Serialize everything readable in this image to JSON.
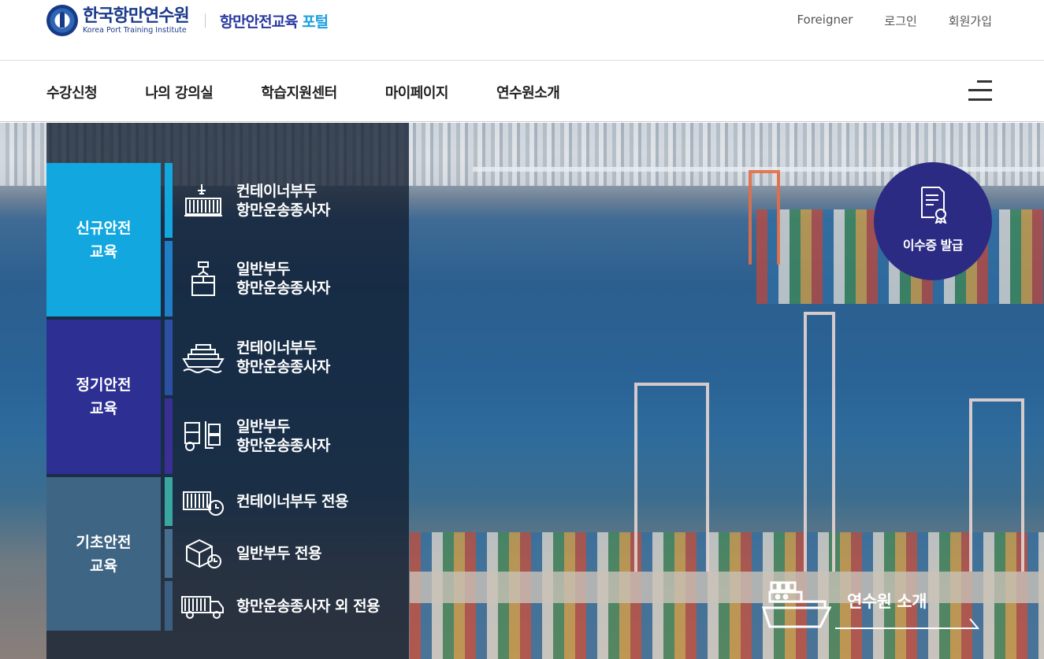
{
  "header": {
    "org_name": "한국항만연수원",
    "org_name_en": "Korea Port Training Institute",
    "portal_title_main": "항만안전교육 ",
    "portal_title_accent": "포털",
    "util_links": [
      "Foreigner",
      "로그인",
      "회원가입"
    ]
  },
  "nav": {
    "items": [
      "수강신청",
      "나의 강의실",
      "학습지원센터",
      "마이페이지",
      "연수원소개"
    ]
  },
  "categories": [
    {
      "label": "신규안전\n교육",
      "color": "#12a7df"
    },
    {
      "label": "정기안전\n교육",
      "color": "#2d2f93"
    },
    {
      "label": "기초안전\n교육",
      "color": "#3f6584"
    }
  ],
  "subcourses": [
    {
      "label": "컨테이너부두\n항만운송종사자",
      "icon": "container-crane-icon"
    },
    {
      "label": "일반부두\n항만운송종사자",
      "icon": "cargo-box-hook-icon"
    },
    {
      "label": "컨테이너부두\n항만운송종사자",
      "icon": "container-ship-icon"
    },
    {
      "label": "일반부두\n항만운송종사자",
      "icon": "forklift-icon"
    },
    {
      "label": "컨테이너부두 전용",
      "icon": "container-clock-icon"
    },
    {
      "label": "일반부두 전용",
      "icon": "box-clock-icon"
    },
    {
      "label": "항만운송종사자 외 전용",
      "icon": "truck-icon"
    }
  ],
  "certificate": {
    "label": "이수증 발급",
    "icon": "certificate-icon"
  },
  "about": {
    "label": "연수원 소개",
    "icon": "ship-icon"
  }
}
